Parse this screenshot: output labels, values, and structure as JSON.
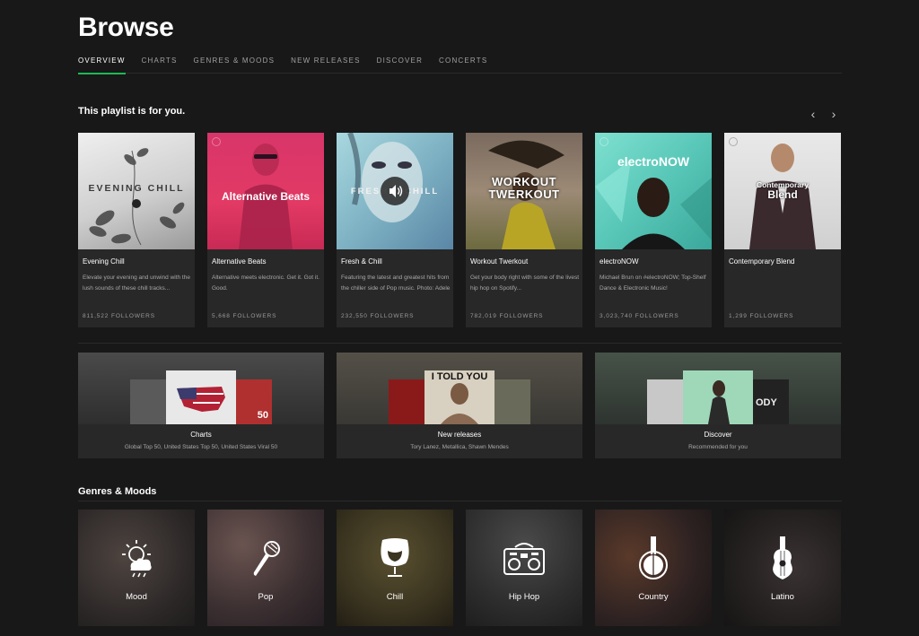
{
  "page_title": "Browse",
  "tabs": [
    {
      "label": "OVERVIEW",
      "active": true
    },
    {
      "label": "CHARTS"
    },
    {
      "label": "GENRES & MOODS"
    },
    {
      "label": "NEW RELEASES"
    },
    {
      "label": "DISCOVER"
    },
    {
      "label": "CONCERTS"
    }
  ],
  "playlist_section": {
    "title": "This playlist is for you.",
    "nav": {
      "prev": "‹",
      "next": "›"
    },
    "cards": [
      {
        "title": "Evening Chill",
        "art_text": "EVENING CHILL",
        "description": "Elevate your evening and unwind with the lush sounds of these chill tracks...",
        "followers": "811,522 FOLLOWERS"
      },
      {
        "title": "Alternative Beats",
        "art_text": "Alternative Beats",
        "description": "Alternative meets electronic. Get it. Got it. Good.",
        "followers": "5,668 FOLLOWERS"
      },
      {
        "title": "Fresh & Chill",
        "art_text": "FRESH & CHILL",
        "description": "Featuring the latest and greatest hits from the chiller side of Pop music. Photo: Adele",
        "followers": "232,550 FOLLOWERS"
      },
      {
        "title": "Workout Twerkout",
        "art_text": "WORKOUT TWERKOUT",
        "description": "Get your body right with some of the livest hip hop on Spotify...",
        "followers": "782,019 FOLLOWERS"
      },
      {
        "title": "electroNOW",
        "art_text": "electroNOW",
        "description": "Michael Brun on #electroNOW; Top-Shelf Dance & Electronic Music!",
        "followers": "3,023,740 FOLLOWERS"
      },
      {
        "title": "Contemporary Blend",
        "art_text_top": "Contemporary",
        "art_text_bottom": "Blend",
        "description": "",
        "followers": "1,299 FOLLOWERS"
      }
    ]
  },
  "features": [
    {
      "title": "Charts",
      "subtitle": "Global Top 50, United States Top 50, United States Viral 50",
      "mini_text": "50"
    },
    {
      "title": "New releases",
      "subtitle": "Tory Lanez, Metallica, Shawn Mendes",
      "mini_text": "I TOLD YOU"
    },
    {
      "title": "Discover",
      "subtitle": "Recommended for you",
      "mini_text": "ODY"
    }
  ],
  "genres_section": {
    "title": "Genres & Moods",
    "items": [
      {
        "label": "Mood",
        "icon": "weather-icon"
      },
      {
        "label": "Pop",
        "icon": "microphone-icon"
      },
      {
        "label": "Chill",
        "icon": "egg-chair-icon"
      },
      {
        "label": "Hip Hop",
        "icon": "boombox-icon"
      },
      {
        "label": "Country",
        "icon": "banjo-icon"
      },
      {
        "label": "Latino",
        "icon": "guitar-icon"
      }
    ]
  },
  "colors": {
    "accent": "#1db954",
    "background": "#181818",
    "card": "#282828"
  }
}
